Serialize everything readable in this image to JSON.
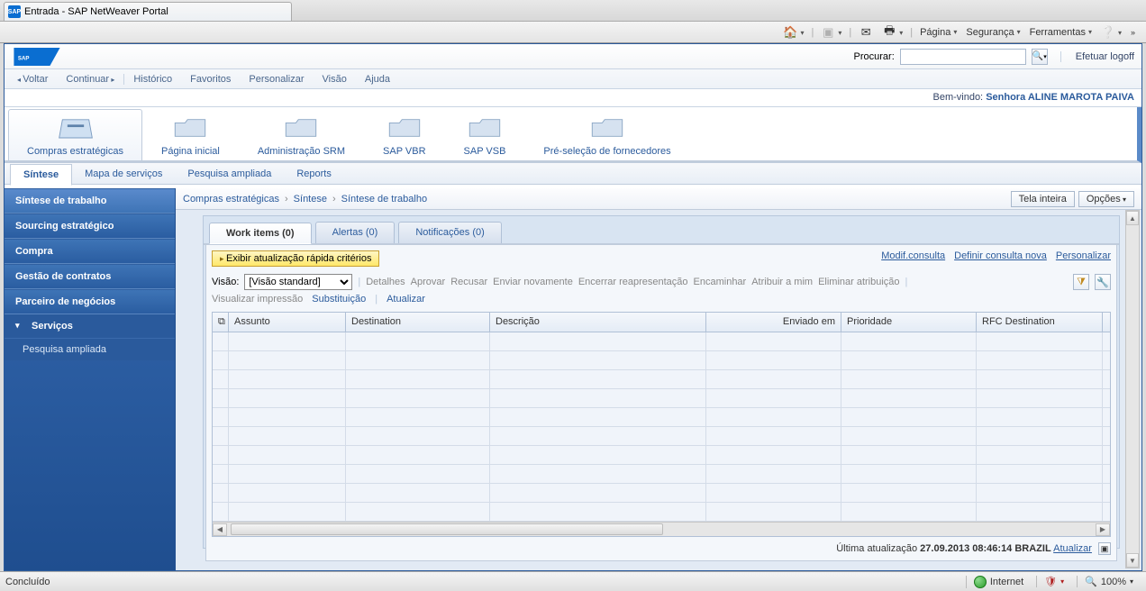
{
  "browser": {
    "tab_title": "Entrada - SAP NetWeaver Portal",
    "menu": {
      "pagina": "Página",
      "seguranca": "Segurança",
      "ferramentas": "Ferramentas"
    }
  },
  "header": {
    "search_label": "Procurar:",
    "search_placeholder": "",
    "logoff": "Efetuar logoff"
  },
  "nav": {
    "voltar": "Voltar",
    "continuar": "Continuar",
    "items": [
      "Histórico",
      "Favoritos",
      "Personalizar",
      "Visão",
      "Ajuda"
    ]
  },
  "welcome": {
    "prefix": "Bem-vindo:",
    "user": "Senhora ALINE MAROTA PAIVA"
  },
  "modules": {
    "items": [
      "Compras estratégicas",
      "Página inicial",
      "Administração SRM",
      "SAP VBR",
      "SAP VSB",
      "Pré-seleção de fornecedores"
    ]
  },
  "subtabs": {
    "items": [
      "Síntese",
      "Mapa de serviços",
      "Pesquisa ampliada",
      "Reports"
    ]
  },
  "left": {
    "items": [
      "Síntese de trabalho",
      "Sourcing estratégico",
      "Compra",
      "Gestão de contratos",
      "Parceiro de negócios"
    ],
    "services": "Serviços",
    "leaf": "Pesquisa ampliada"
  },
  "breadcrumb": {
    "a": "Compras estratégicas",
    "b": "Síntese",
    "c": "Síntese de trabalho",
    "tela_inteira": "Tela inteira",
    "opcoes": "Opções"
  },
  "ctabs": {
    "work": "Work items (0)",
    "alertas": "Alertas (0)",
    "notif": "Notificações (0)"
  },
  "panel": {
    "exibir": "Exibir atualização rápida critérios",
    "links": {
      "modif": "Modif.consulta",
      "definir": "Definir consulta nova",
      "pers": "Personalizar"
    },
    "visao_label": "Visão:",
    "visao_value": "[Visão standard]",
    "actions": [
      "Detalhes",
      "Aprovar",
      "Recusar",
      "Enviar novamente",
      "Encerrar reapresentação",
      "Encaminhar",
      "Atribuir a mim",
      "Eliminar atribuição"
    ],
    "actions2": {
      "imp": "Visualizar impressão",
      "sub": "Substituição",
      "atu": "Atualizar"
    }
  },
  "grid_cols": [
    "",
    "Assunto",
    "Destination",
    "Descrição",
    "Enviado em",
    "Prioridade",
    "RFC Destination"
  ],
  "grid_widths": [
    18,
    130,
    160,
    240,
    150,
    150,
    140
  ],
  "footer": {
    "label": "Última atualização",
    "ts": "27.09.2013 08:46:14 BRAZIL",
    "refresh": "Atualizar"
  },
  "status": {
    "concluido": "Concluído",
    "internet": "Internet",
    "zoom": "100%"
  }
}
